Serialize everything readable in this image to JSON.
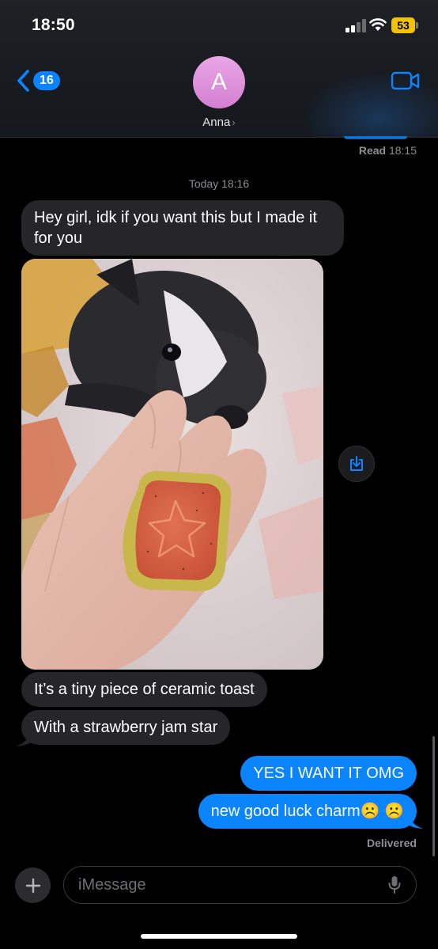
{
  "status_bar": {
    "time": "18:50",
    "battery": "53"
  },
  "header": {
    "back_count": "16",
    "avatar_initial": "A",
    "contact_name": "Anna"
  },
  "thread": {
    "read_receipt_label": "Read",
    "read_receipt_time": "18:15",
    "timestamp": "Today 18:16",
    "messages": [
      {
        "text": "Hey girl, idk if you want this but I made it for you"
      },
      {
        "text": "It’s a tiny piece of ceramic toast"
      },
      {
        "text": "With a strawberry jam star"
      },
      {
        "text": "YES I WANT IT OMG"
      },
      {
        "text": "new good luck charm☹️ ☹️"
      }
    ],
    "delivered": "Delivered"
  },
  "composer": {
    "placeholder": "iMessage"
  },
  "colors": {
    "outgoing": "#0a84ff",
    "incoming": "#262628",
    "avatar": "#d98bd6",
    "battery": "#f2c200"
  },
  "icons": [
    "back-chevron-icon",
    "video-camera-icon",
    "save-icon",
    "plus-icon",
    "microphone-icon",
    "wifi-icon",
    "signal-icon"
  ]
}
